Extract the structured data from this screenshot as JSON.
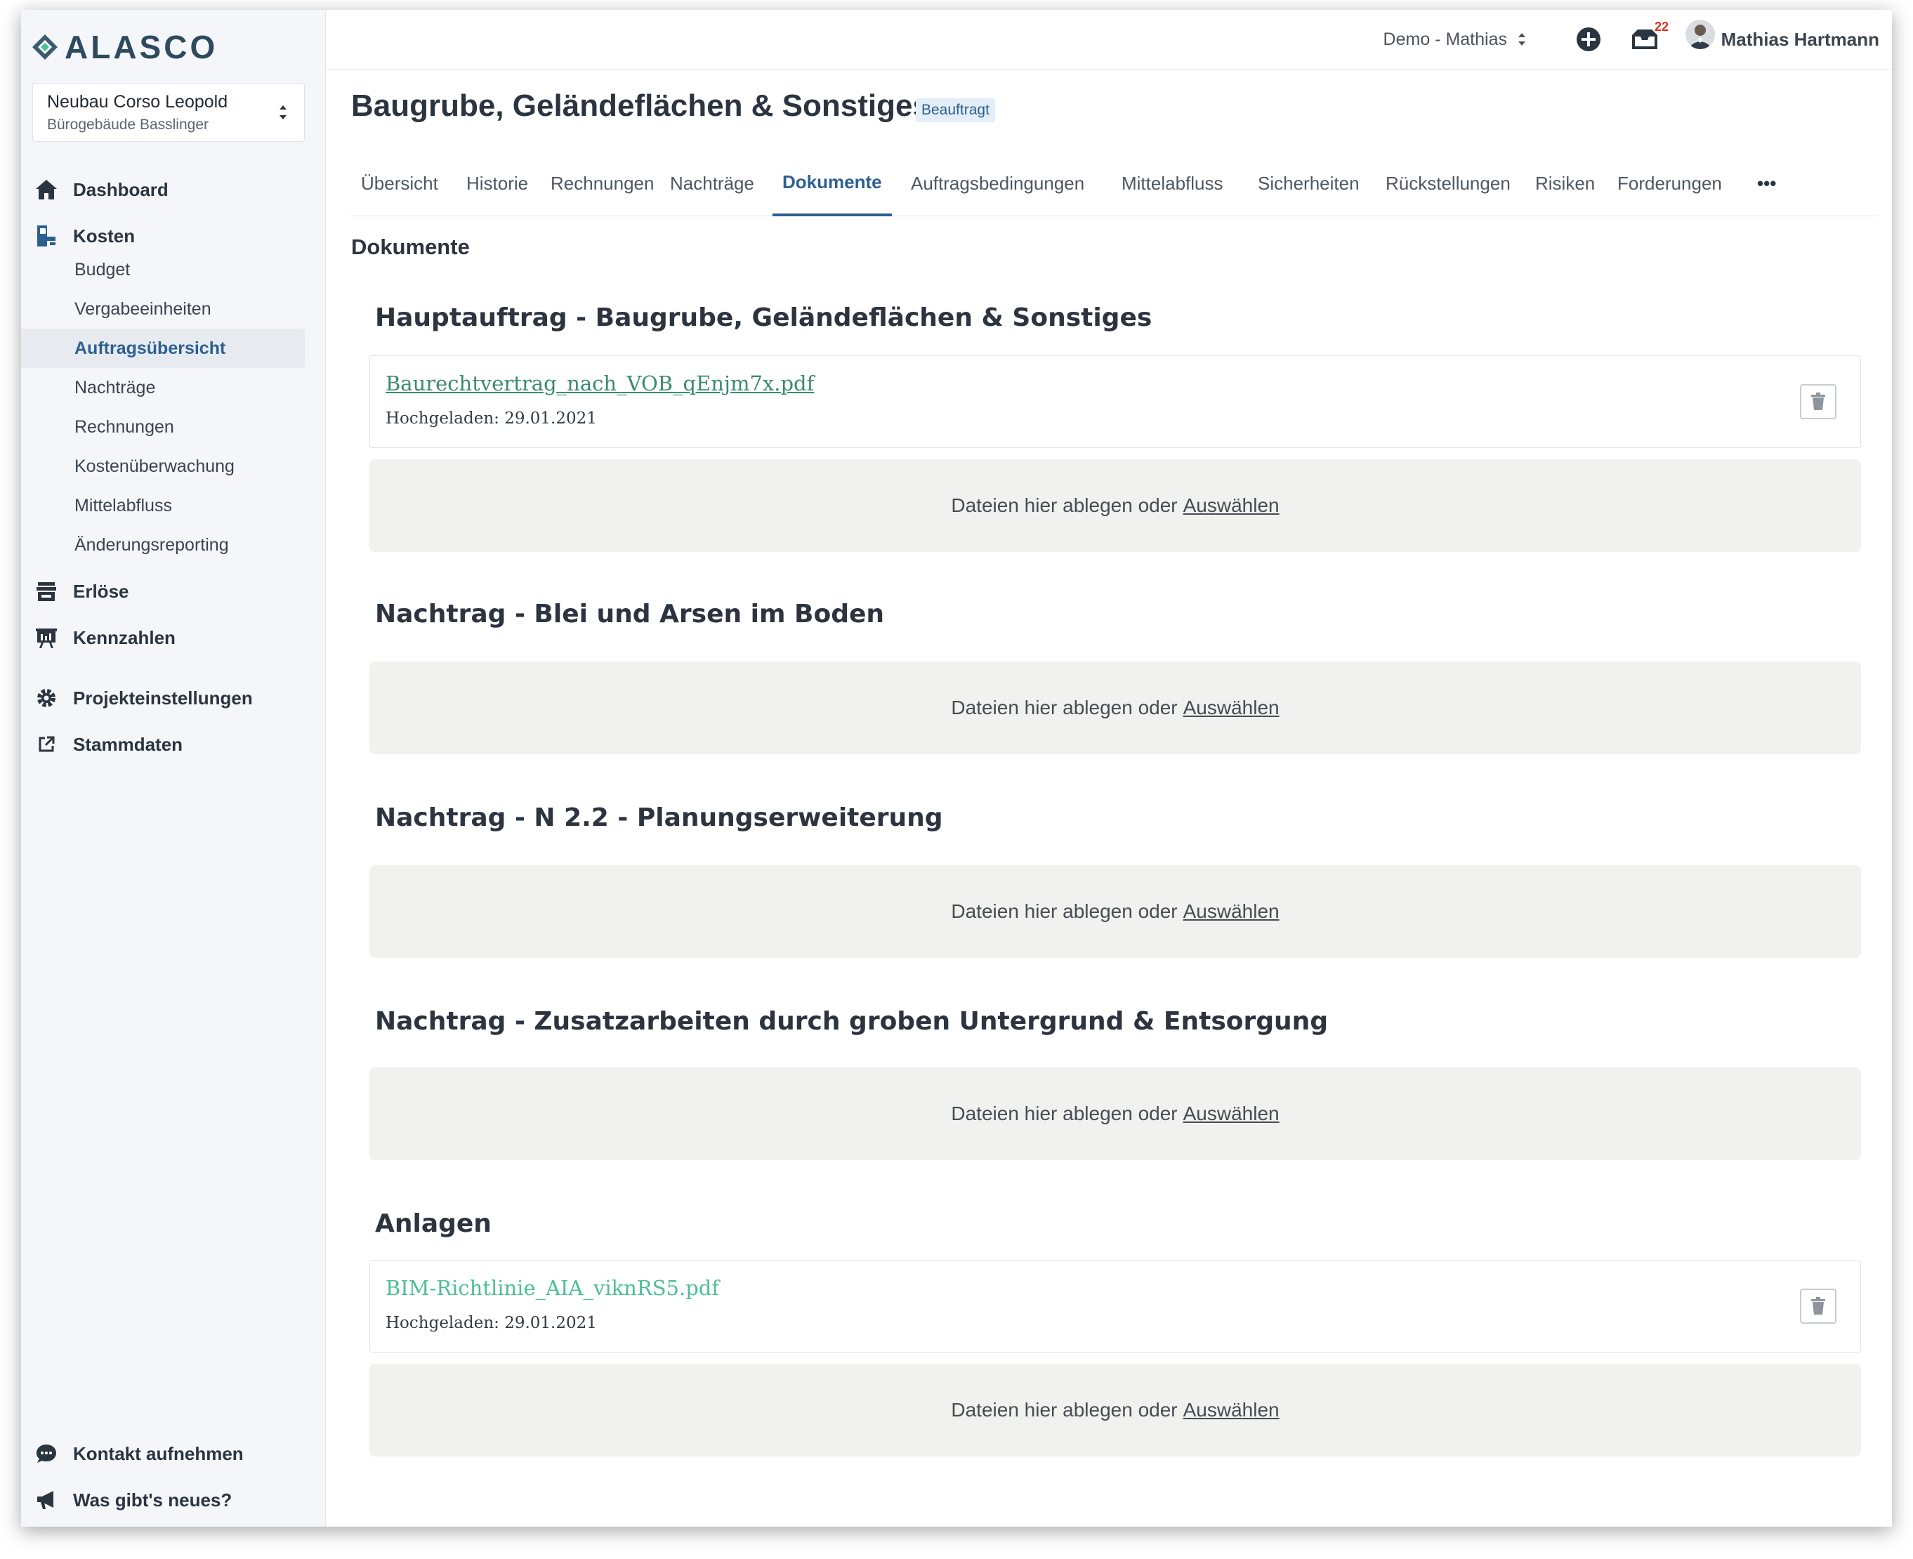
{
  "app": {
    "logo_text": "ALASCO"
  },
  "project": {
    "name": "Neubau Corso Leopold",
    "subtitle": "Bürogebäude Basslinger"
  },
  "sidebar": {
    "main_items": [
      {
        "label": "Dashboard",
        "icon": "home-icon"
      },
      {
        "label": "Kosten",
        "icon": "costs-icon"
      },
      {
        "label": "Erlöse",
        "icon": "revenue-icon"
      },
      {
        "label": "Kennzahlen",
        "icon": "chart-icon"
      },
      {
        "label": "Projekteinstellungen",
        "icon": "gear-icon"
      },
      {
        "label": "Stammdaten",
        "icon": "external-link-icon"
      }
    ],
    "kosten_sub": [
      {
        "label": "Budget"
      },
      {
        "label": "Vergabeeinheiten"
      },
      {
        "label": "Auftragsübersicht",
        "active": true
      },
      {
        "label": "Nachträge"
      },
      {
        "label": "Rechnungen"
      },
      {
        "label": "Kostenüberwachung"
      },
      {
        "label": "Mittelabfluss"
      },
      {
        "label": "Änderungsreporting"
      }
    ],
    "footer": [
      {
        "label": "Kontakt aufnehmen",
        "icon": "chat-icon"
      },
      {
        "label": "Was gibt's neues?",
        "icon": "megaphone-icon"
      }
    ]
  },
  "topbar": {
    "workspace": "Demo - Mathias",
    "notification_count": "22",
    "user_name": "Mathias Hartmann"
  },
  "page": {
    "title": "Baugrube, Geländeflächen & Sonstiges",
    "status": "Beauftragt",
    "section_title": "Dokumente"
  },
  "tabs": [
    {
      "label": "Übersicht"
    },
    {
      "label": "Historie"
    },
    {
      "label": "Rechnungen"
    },
    {
      "label": "Nachträge"
    },
    {
      "label": "Dokumente",
      "active": true
    },
    {
      "label": "Auftragsbedingungen"
    },
    {
      "label": "Mittelabfluss"
    },
    {
      "label": "Sicherheiten"
    },
    {
      "label": "Rückstellungen"
    },
    {
      "label": "Risiken"
    },
    {
      "label": "Forderungen"
    }
  ],
  "more_tabs_label": "•••",
  "dropzone": {
    "text": "Dateien hier ablegen oder",
    "link": "Auswählen"
  },
  "groups": [
    {
      "title": "Hauptauftrag - Baugrube, Geländeflächen & Sonstiges",
      "files": [
        {
          "name": "Baurechtvertrag_nach_VOB_qEnjm7x.pdf",
          "uploaded": "Hochgeladen: 29.01.2021"
        }
      ]
    },
    {
      "title": "Nachtrag - Blei und Arsen im Boden",
      "files": []
    },
    {
      "title": "Nachtrag - N 2.2 - Planungserweiterung",
      "files": []
    },
    {
      "title": "Nachtrag - Zusatzarbeiten durch groben Untergrund & Entsorgung",
      "files": []
    },
    {
      "title": "Anlagen",
      "files": [
        {
          "name": "BIM-Richtlinie_AIA_viknRS5.pdf",
          "uploaded": "Hochgeladen: 29.01.2021"
        }
      ]
    }
  ]
}
